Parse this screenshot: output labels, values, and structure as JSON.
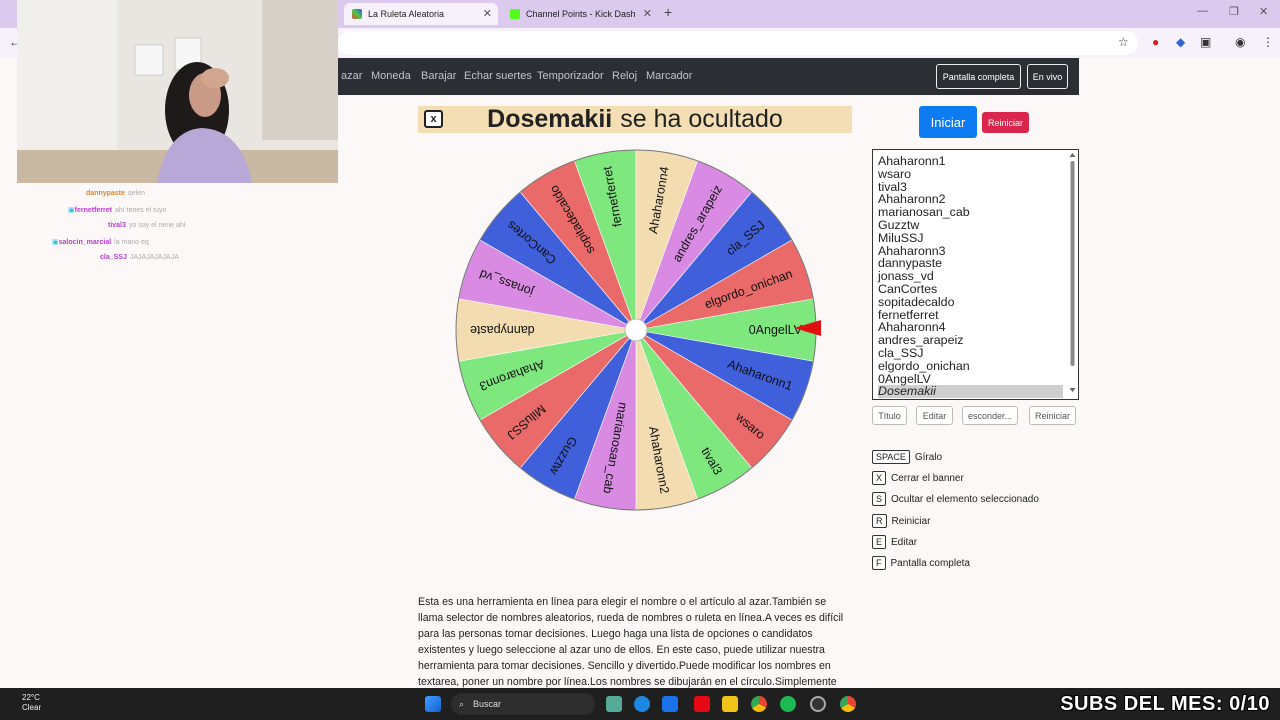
{
  "browser": {
    "tabs": [
      {
        "label": "La Ruleta Aleatoria",
        "active": true
      },
      {
        "label": "Channel Points - Kick Dashboard",
        "active": false
      }
    ],
    "new_tab": "+"
  },
  "nav": {
    "links": [
      "azar",
      "Moneda",
      "Barajar",
      "Echar suertes",
      "Temporizador",
      "Reloj",
      "Marcador"
    ],
    "fullscreen_label": "Pantalla completa",
    "live_label": "En vivo"
  },
  "banner": {
    "close_label": "x",
    "name": "Dosemakii",
    "message": "se ha ocultado"
  },
  "wheel": {
    "segments": [
      {
        "label": "0AngelLV",
        "color": "#7ee87e"
      },
      {
        "label": "Ahaharonn1",
        "color": "#3f5fdb"
      },
      {
        "label": "wsaro",
        "color": "#ea6a6a"
      },
      {
        "label": "tival3",
        "color": "#7ee87e"
      },
      {
        "label": "Ahaharonn2",
        "color": "#f2dcb0"
      },
      {
        "label": "marianosan_cab",
        "color": "#d98be3"
      },
      {
        "label": "Guzztw",
        "color": "#3f5fdb"
      },
      {
        "label": "MiluSSJ",
        "color": "#ea6a6a"
      },
      {
        "label": "Ahaharonn3",
        "color": "#7ee87e"
      },
      {
        "label": "dannypaste",
        "color": "#f2dcb0"
      },
      {
        "label": "jonass_vd",
        "color": "#d98be3"
      },
      {
        "label": "CanCortes",
        "color": "#3f5fdb"
      },
      {
        "label": "sopitadecaldo",
        "color": "#ea6a6a"
      },
      {
        "label": "fernetferret",
        "color": "#7ee87e"
      },
      {
        "label": "Ahaharonn4",
        "color": "#f2dcb0"
      },
      {
        "label": "andres_arapeiz",
        "color": "#d98be3"
      },
      {
        "label": "cla_SSJ",
        "color": "#3f5fdb"
      },
      {
        "label": "elgordo_onichan",
        "color": "#ea6a6a"
      }
    ],
    "pointer_color": "#e01010"
  },
  "controls": {
    "start_label": "Iniciar",
    "reset_label": "Reiniciar",
    "names": [
      "Ahaharonn1",
      "wsaro",
      "tival3",
      "Ahaharonn2",
      "marianosan_cab",
      "Guzztw",
      "MiluSSJ",
      "Ahaharonn3",
      "dannypaste",
      "jonass_vd",
      "CanCortes",
      "sopitadecaldo",
      "fernetferret",
      "Ahaharonn4",
      "andres_arapeiz",
      "cla_SSJ",
      "elgordo_onichan",
      "0AngelLV",
      "Dosemakii"
    ],
    "selected": "Dosemakii",
    "buttons": [
      "Título",
      "Editar",
      "esconder...",
      "Reiniciar"
    ]
  },
  "shortcuts": [
    {
      "key": "SPACE",
      "label": "Gíralo"
    },
    {
      "key": "X",
      "label": "Cerrar el banner"
    },
    {
      "key": "S",
      "label": "Ocultar el elemento seleccionado"
    },
    {
      "key": "R",
      "label": "Reiniciar"
    },
    {
      "key": "E",
      "label": "Editar"
    },
    {
      "key": "F",
      "label": "Pantalla completa"
    }
  ],
  "description": "Esta es una herramienta en línea para elegir el nombre o el artículo al azar.También se llama selector de nombres aleatorios, rueda de nombres o ruleta en línea.A veces es difícil para las personas tomar decisiones. Luego haga una lista de opciones o candidatos existentes y luego seleccione al azar uno de ellos. En este caso, puede utilizar nuestra herramienta para tomar decisiones. Sencillo y divertido.Puede modificar los nombres en textarea, poner un nombre por línea.Los nombres se dibujarán en el círculo.Simplemente haga clic en la rueda",
  "chat": [
    {
      "user": "dannypaste",
      "text": "qelen",
      "color": "orange"
    },
    {
      "user": "fernetferret",
      "text": "ahí tenes el tuyo",
      "color": "purple"
    },
    {
      "user": "tival3",
      "text": "yo soy el nene ahí",
      "color": "purple"
    },
    {
      "user": "salocin_marcial",
      "text": "la mano eq",
      "color": "purple"
    },
    {
      "user": "cla_SSJ",
      "text": "JAJAJAJAJAJA",
      "color": "purple"
    }
  ],
  "taskbar": {
    "search_label": "Buscar",
    "weather_temp": "22°C",
    "weather_desc": "Clear"
  },
  "overlay": {
    "subs_text": "SUBS DEL MES: 0/10"
  }
}
